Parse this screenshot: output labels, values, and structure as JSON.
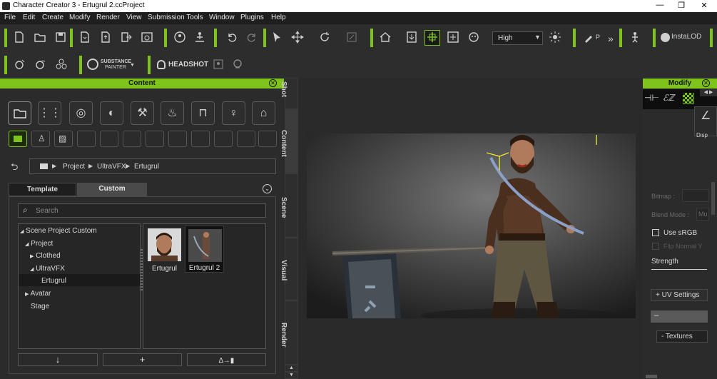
{
  "window": {
    "title": "Character Creator 3 - Ertugrul 2.ccProject",
    "min": "—",
    "max": "❐",
    "close": "✕"
  },
  "menu": [
    "File",
    "Edit",
    "Create",
    "Modify",
    "Render",
    "View",
    "Submission Tools",
    "Window",
    "Plugins",
    "Help"
  ],
  "toolbar": {
    "quality_value": "High",
    "instalod_label": "InstaLOD",
    "p_label": "P",
    "substance_top": "SUBSTANCE",
    "substance_bottom": "PAINTER",
    "headshot_label": "HEADSHOT"
  },
  "content_panel": {
    "title": "Content",
    "breadcrumb": [
      "Project",
      "UltraVFX",
      "Ertugrul"
    ],
    "tabs": [
      "Template",
      "Custom"
    ],
    "active_tab": "Custom",
    "search_placeholder": "Search",
    "tree": [
      {
        "label": "Scene Project Custom",
        "arrow": "◢"
      },
      {
        "label": "Project",
        "arrow": "◢"
      },
      {
        "label": "Clothed",
        "arrow": "▶"
      },
      {
        "label": "UltraVFX",
        "arrow": "◢"
      },
      {
        "label": "Ertugrul",
        "arrow": ""
      },
      {
        "label": "Avatar",
        "arrow": "▶"
      },
      {
        "label": "Stage",
        "arrow": ""
      }
    ],
    "selected_tree_item": "Ertugrul",
    "thumbnails": [
      {
        "label": "Ertugrul"
      },
      {
        "label": "Ertugrul 2"
      }
    ]
  },
  "side_tabs": [
    "Shot",
    "Content",
    "Scene",
    "Visual",
    "Render"
  ],
  "modify_panel": {
    "title": "Modify",
    "disp_label": "Disp",
    "bitmap_label": "Bitmap :",
    "blend_label": "Blend Mode :",
    "blend_value": "Mu",
    "use_srgb": "Use sRGB",
    "flip_normal": "Flip Normal Y",
    "strength": "Strength",
    "uv_settings": "+ UV Settings",
    "collapsed": "–",
    "textures": "- Textures"
  },
  "colors": {
    "accent": "#7fc41c",
    "panel_bg": "#2b2b2b",
    "viewport_bg": "#3a3a3a"
  }
}
